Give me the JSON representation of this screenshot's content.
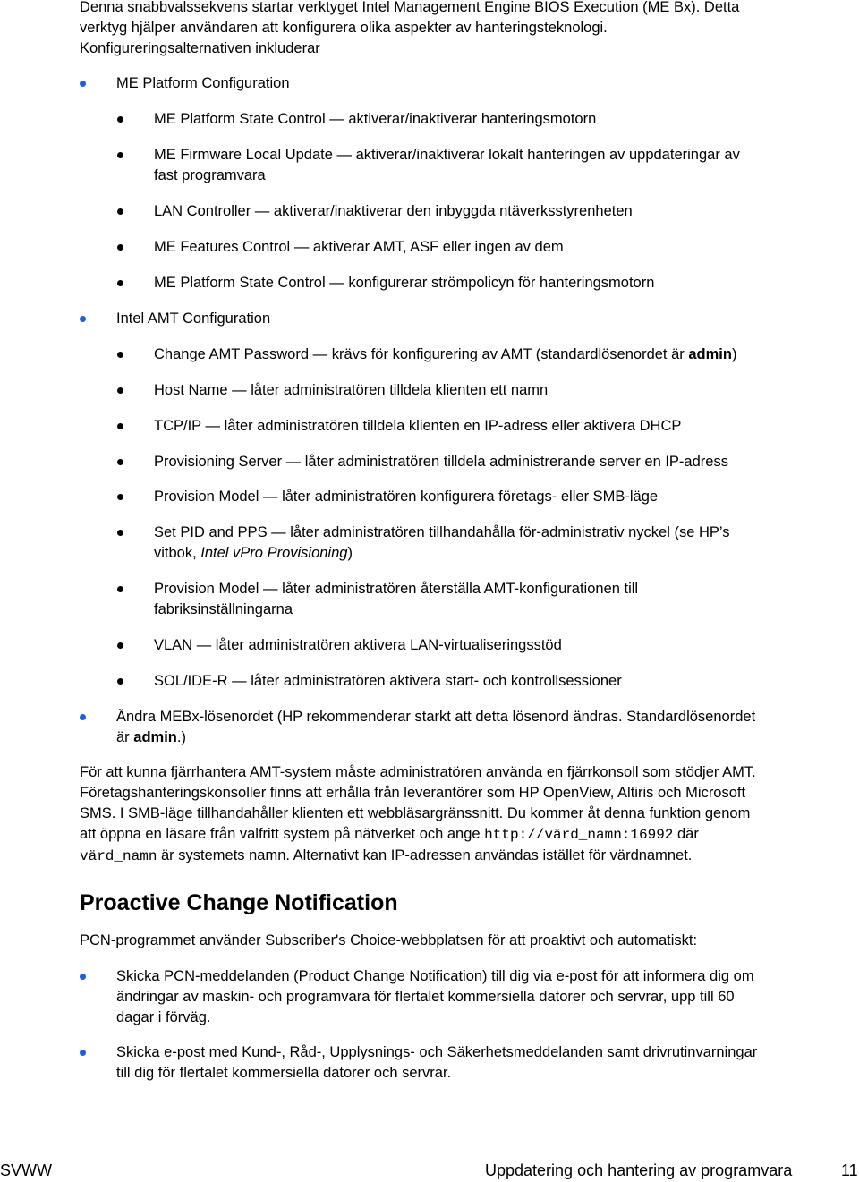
{
  "intro": {
    "line1": "Denna snabbvalssekvens startar verktyget Intel Management Engine BIOS Execution (ME Bx). Detta",
    "line2": "verktyg hjälper användaren att konfigurera olika aspekter av hanteringsteknologi.",
    "line3": "Konfigureringsalternativen inkluderar"
  },
  "bullet_colors": {
    "level1": "#1a5fe0",
    "level2": "#000000"
  },
  "me_platform": {
    "label": "ME Platform Configuration",
    "items": [
      {
        "name": "ME Platform State Control",
        "desc": "aktiverar/inaktiverar hanteringsmotorn"
      },
      {
        "name": "ME Firmware Local Update",
        "desc": "aktiverar/inaktiverar lokalt hanteringen av uppdateringar av",
        "desc2": "fast programvara"
      },
      {
        "name": "LAN Controller",
        "desc": "aktiverar/inaktiverar den inbyggda ntäverksstyrenheten"
      },
      {
        "name": "ME Features Control",
        "desc": "aktiverar AMT, ASF eller ingen av dem"
      },
      {
        "name": "ME Platform State Control",
        "desc": "konfigurerar strömpolicyn för hanteringsmotorn"
      }
    ]
  },
  "intel_amt": {
    "label": "Intel AMT Configuration",
    "items": [
      {
        "name": "Change AMT Password",
        "desc": "krävs för konfigurering av AMT (standardlösenordet är ",
        "bold": "admin",
        "tail": ")"
      },
      {
        "name": "Host Name",
        "desc": "låter administratören tilldela klienten ett namn"
      },
      {
        "name": "TCP/IP",
        "desc": "låter administratören tilldela klienten en IP-adress eller aktivera DHCP"
      },
      {
        "name": "Provisioning Server",
        "desc": "låter administratören tilldela administrerande server en IP-adress"
      },
      {
        "name": "Provision Model",
        "desc": "låter administratören konfigurera företags- eller SMB-läge"
      },
      {
        "name": "Set PID and PPS",
        "desc": "låter administratören tillhandahålla för-administrativ nyckel (se HP’s",
        "desc2_pre": "vitbok, ",
        "italic": "Intel vPro Provisioning",
        "desc2_post": ")"
      },
      {
        "name": "Provision Model",
        "desc": "låter administratören återställa AMT-konfigurationen till",
        "desc2": "fabriksinställningarna"
      },
      {
        "name": "VLAN",
        "desc": "låter administratören aktivera LAN-virtualiseringsstöd"
      },
      {
        "name": "SOL/IDE-R",
        "desc": "låter administratören aktivera start- och kontrollsessioner"
      }
    ]
  },
  "mebx_password": {
    "line1": "Ändra MEBx-lösenordet (HP rekommenderar starkt att detta lösenord ändras. Standardlösenordet",
    "line2_pre": "är ",
    "line2_bold": "admin",
    "line2_post": ".)"
  },
  "remote": {
    "line1": "För att kunna fjärrhantera AMT-system måste administratören använda en fjärrkonsoll som stödjer AMT.",
    "line2": "Företagshanteringskonsoller finns att erhålla från leverantörer som HP OpenView, Altiris och Microsoft",
    "line3": "SMS. I SMB-läge tillhandahåller klienten ett webbläsargränssnitt. Du kommer åt denna funktion genom",
    "line4_pre": "att öppna en läsare från valfritt system på nätverket och ange ",
    "line4_code": "http://värd_namn:16992",
    "line4_post": " där",
    "line5_code": "värd_namn",
    "line5_post": " är systemets namn. Alternativt kan IP-adressen användas istället för värdnamnet."
  },
  "pcn": {
    "heading": "Proactive Change Notification",
    "intro": "PCN-programmet använder Subscriber's Choice-webbplatsen för att proaktivt och automatiskt:",
    "items": [
      {
        "line1": "Skicka PCN-meddelanden (Product Change Notification) till dig via e-post för att informera dig om",
        "line2": "ändringar av maskin- och programvara för flertalet kommersiella datorer och servrar, upp till 60",
        "line3": "dagar i förväg."
      },
      {
        "line1": "Skicka e-post med Kund-, Råd-, Upplysnings- och Säkerhetsmeddelanden samt drivrutinvarningar",
        "line2": "till dig för flertalet kommersiella datorer och servrar."
      }
    ]
  },
  "footer": {
    "left": "SVWW",
    "title": "Uppdatering och hantering av programvara",
    "page": "11"
  },
  "dash": " — "
}
